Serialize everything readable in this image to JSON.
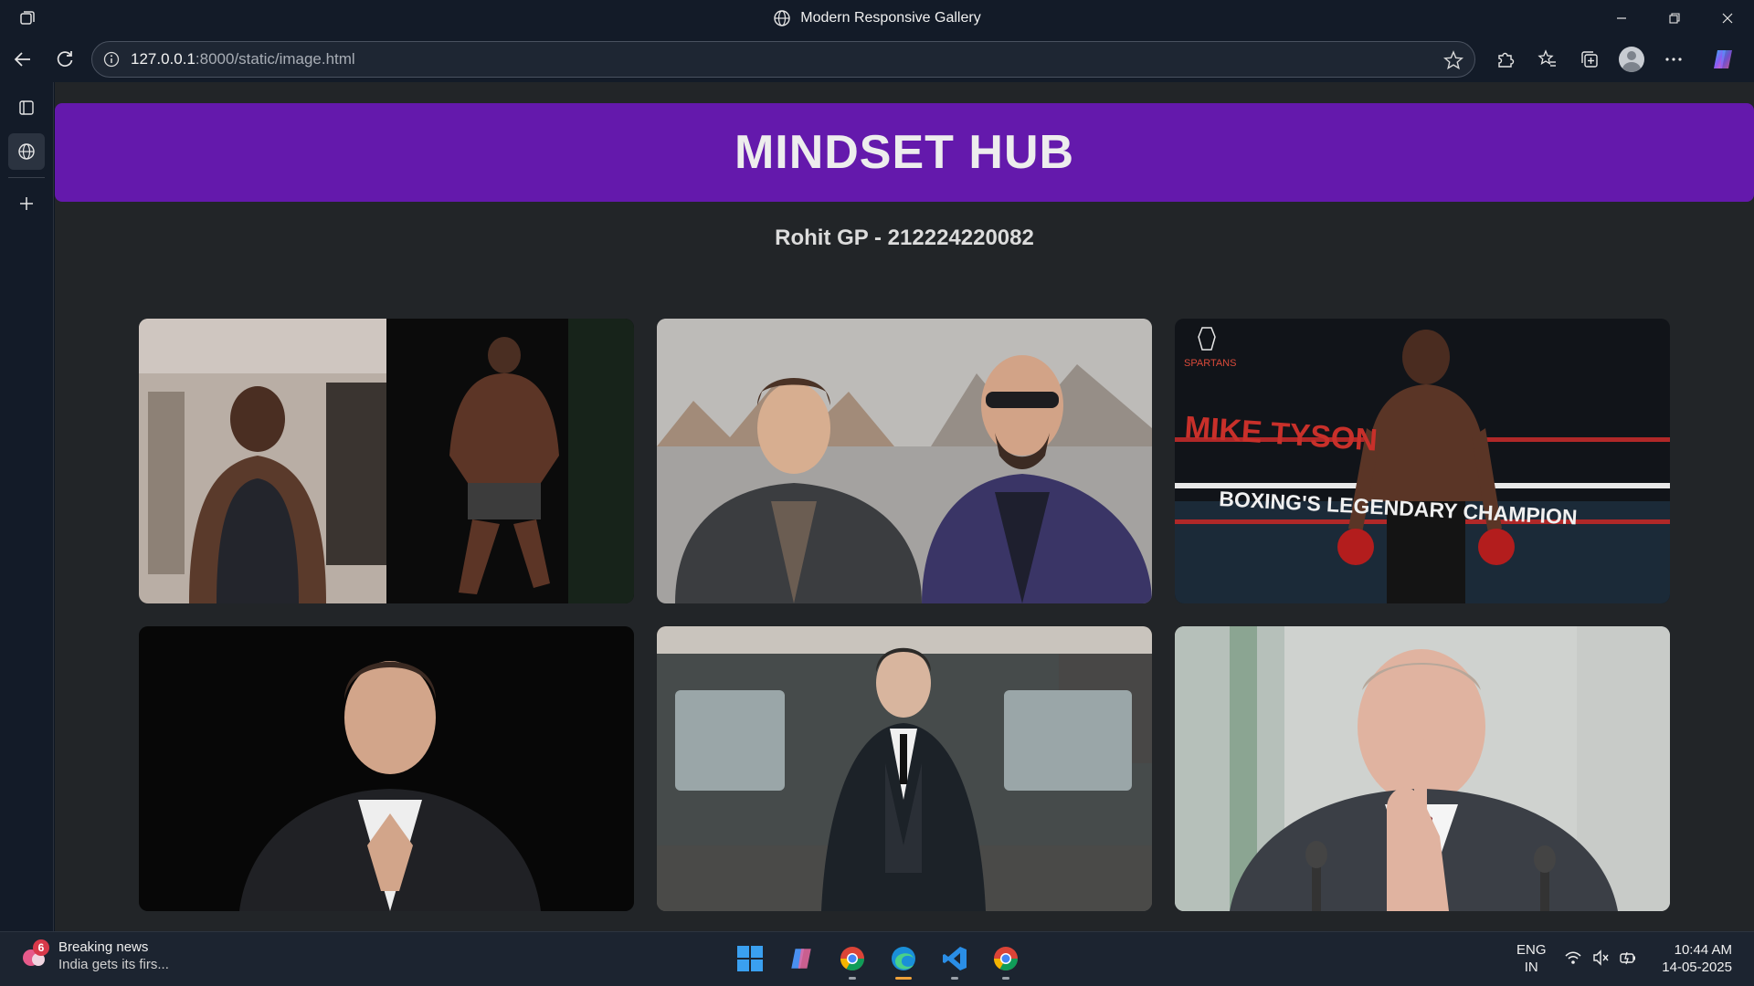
{
  "window": {
    "title": "Modern Responsive Gallery"
  },
  "address_bar": {
    "host": "127.0.0.1",
    "path": ":8000/static/image.html"
  },
  "page": {
    "header_title": "MINDSET HUB",
    "subtitle": "Rohit GP - 212224220082",
    "gallery": [
      {
        "name": "transformation-photo",
        "description": "before-after fitness transformation"
      },
      {
        "name": "two-men-suits-photo",
        "description": "two men in coats"
      },
      {
        "name": "boxer-photo",
        "overlay_title": "MIKE TYSON",
        "overlay_subtitle": "BOXING'S LEGENDARY CHAMPION",
        "logo_text": "SPARTANS"
      },
      {
        "name": "businessman-photo",
        "description": "man in suit, hands steepled, dark background"
      },
      {
        "name": "vintage-car-man-photo",
        "description": "man in three-piece suit by vintage car"
      },
      {
        "name": "finger-to-lips-photo",
        "description": "man in suit with finger on lips"
      }
    ]
  },
  "taskbar": {
    "news_badge": "6",
    "news_title": "Breaking news",
    "news_snippet": "India gets its firs...",
    "lang_1": "ENG",
    "lang_2": "IN",
    "time": "10:44 AM",
    "date": "14-05-2025"
  },
  "colors": {
    "header_bg": "#6419ac",
    "page_bg": "#222528",
    "browser_chrome": "#131b28",
    "accent_overlay": "#c8302a"
  }
}
